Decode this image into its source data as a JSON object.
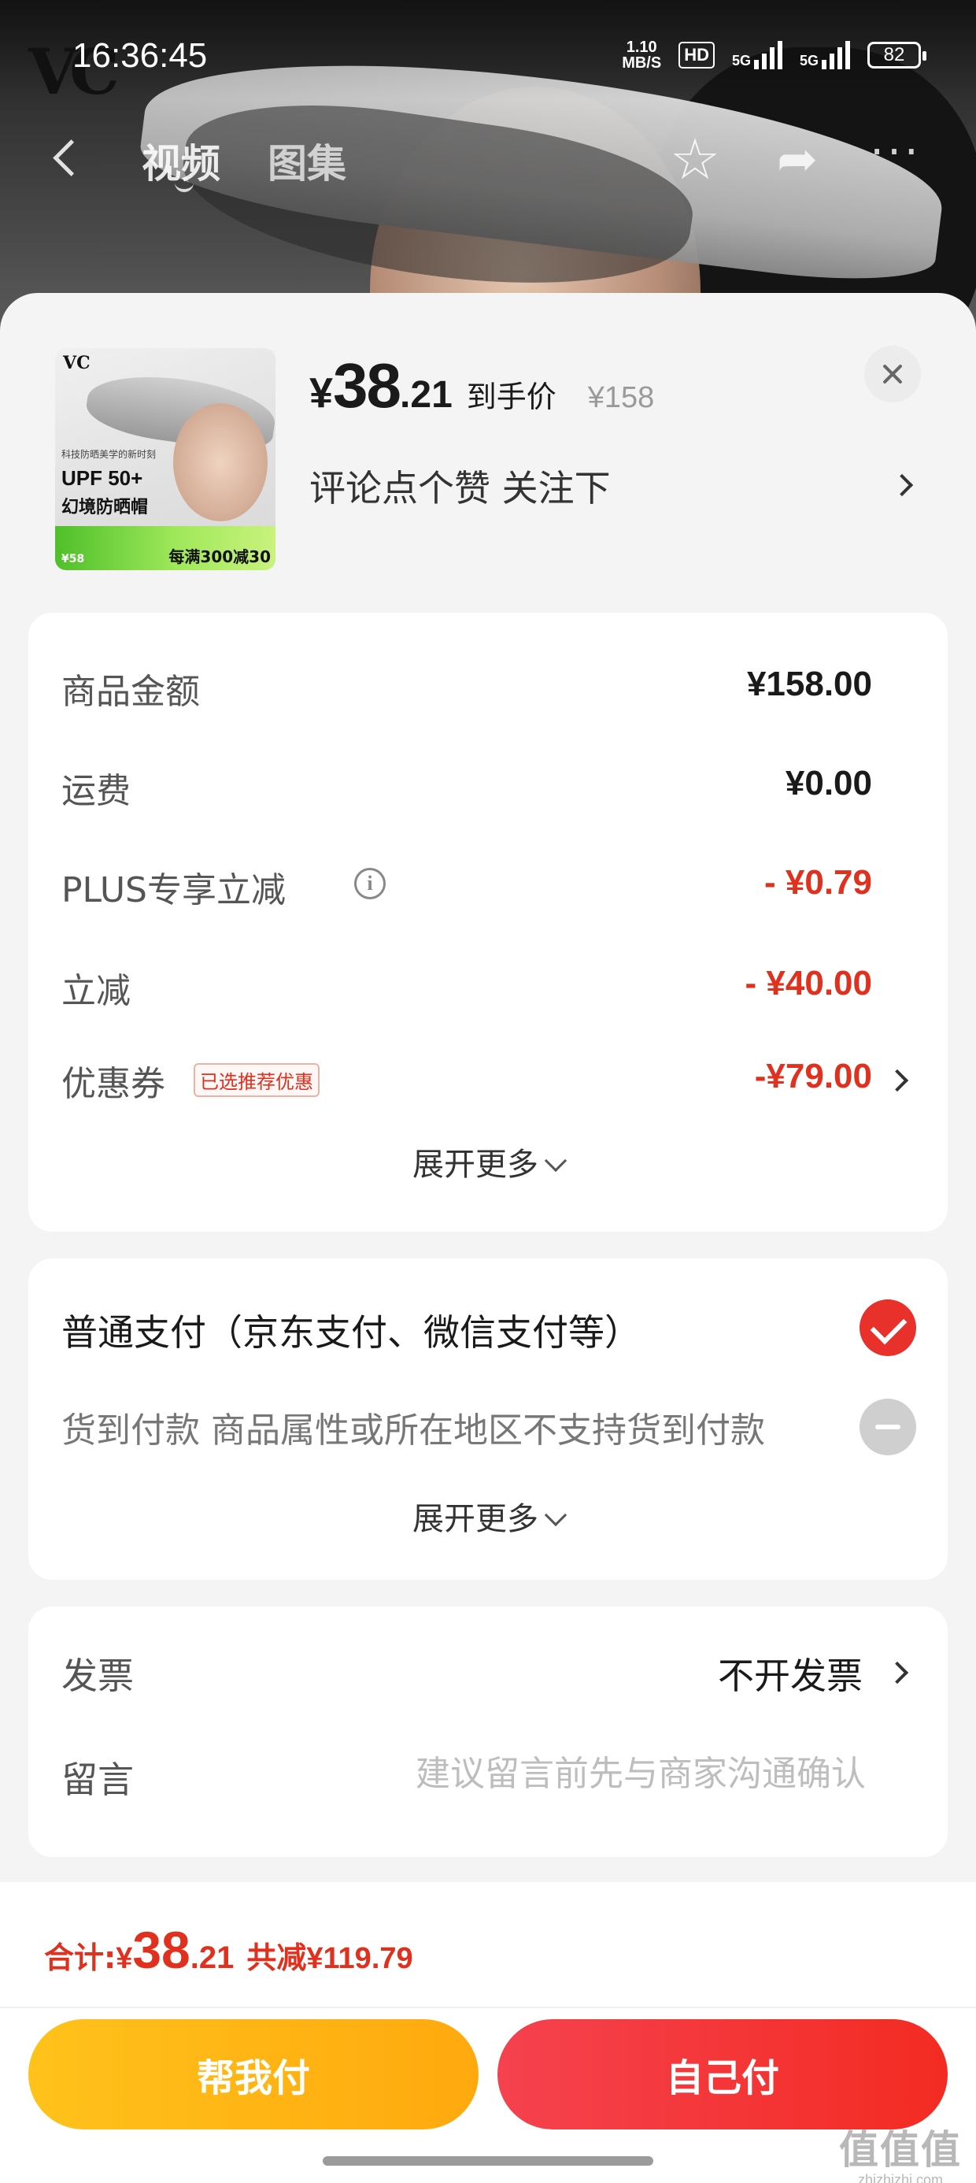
{
  "status_bar": {
    "time": "16:36:45",
    "net_speed_value": "1.10",
    "net_speed_unit": "MB/S",
    "hd_badge": "HD",
    "signal_1_label": "5G",
    "signal_2_label": "5G",
    "battery": "82"
  },
  "backdrop": {
    "brand_logo": "VC"
  },
  "nav": {
    "tabs": [
      {
        "label": "视频",
        "active": true
      },
      {
        "label": "图集",
        "active": false
      }
    ],
    "icons": [
      "back-icon",
      "star-icon",
      "share-icon",
      "more-icon"
    ]
  },
  "product": {
    "thumbnail": {
      "logo": "VC",
      "tagline": "科技防晒美学的新时刻",
      "upf": "UPF 50+",
      "name": "幻境防晒帽",
      "promo_price": "¥58",
      "promo": "每满300减30"
    },
    "price_yen": "¥",
    "price_int": "38",
    "price_dec": ".21",
    "price_label": "到手价",
    "original_price": "¥158",
    "subtitle": "评论点个赞 关注下"
  },
  "amounts": {
    "rows": [
      {
        "label": "商品金额",
        "value": "¥158.00"
      },
      {
        "label": "运费",
        "value": "¥0.00"
      },
      {
        "label": "PLUS专享立减",
        "value": "- ¥0.79"
      },
      {
        "label": "立减",
        "value": "- ¥40.00"
      },
      {
        "label": "优惠券",
        "badge": "已选推荐优惠",
        "value": "-¥79.00"
      }
    ],
    "expand_label": "展开更多"
  },
  "payment": {
    "options": [
      {
        "label": "普通支付（京东支付、微信支付等）",
        "selected": true
      },
      {
        "label": "货到付款 商品属性或所在地区不支持货到付款",
        "enabled": false
      }
    ],
    "expand_label": "展开更多"
  },
  "extra": {
    "invoice_label": "发票",
    "invoice_value": "不开发票",
    "message_label": "留言",
    "message_placeholder": "建议留言前先与商家沟通确认",
    "message_value": ""
  },
  "footer": {
    "total_label": "合计:",
    "total_yen": "¥",
    "total_int": "38",
    "total_dec": ".21",
    "total_discount": "共减¥119.79",
    "friend_pay_label": "帮我付",
    "self_pay_label": "自己付",
    "watermark_glyph": "值值值",
    "watermark_url": "zhizhizhi.com"
  },
  "colors": {
    "accent_red": "#e0301e",
    "button_yellow": "#ffb514",
    "button_red": "#f3382f"
  }
}
